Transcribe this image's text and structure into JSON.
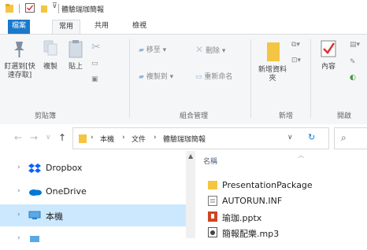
{
  "window": {
    "title": "體驗瑞珈簡報"
  },
  "ribbon_tabs": [
    {
      "label": "檔案"
    },
    {
      "label": "常用"
    },
    {
      "label": "共用"
    },
    {
      "label": "檢視"
    }
  ],
  "ribbon": {
    "pin_label": "釘選到[快速存取]",
    "copy_label": "複製",
    "paste_label": "貼上",
    "move_label": "移至",
    "copyto_label": "複製到",
    "delete_label": "刪除",
    "rename_label": "重新命名",
    "newfolder_label": "新增資料夾",
    "properties_label": "內容",
    "groups": {
      "clipboard": "剪貼簿",
      "organize": "組合管理",
      "new": "新增",
      "open": "開啟"
    }
  },
  "address": {
    "crumbs": [
      "本機",
      "文件",
      "體驗瑞珈簡報"
    ]
  },
  "nav_pane": {
    "items": [
      {
        "label": "Dropbox"
      },
      {
        "label": "OneDrive"
      },
      {
        "label": "本機"
      }
    ]
  },
  "file_list": {
    "column_name": "名稱",
    "files": [
      {
        "name": "PresentationPackage",
        "icon": "folder-icon"
      },
      {
        "name": "AUTORUN.INF",
        "icon": "setup-file-icon"
      },
      {
        "name": "瑜珈.pptx",
        "icon": "powerpoint-icon"
      },
      {
        "name": "簡報配樂.mp3",
        "icon": "audio-file-icon"
      }
    ]
  },
  "colors": {
    "accent": "#1979ca",
    "selection": "#cce8ff",
    "folder": "#f4c542"
  }
}
